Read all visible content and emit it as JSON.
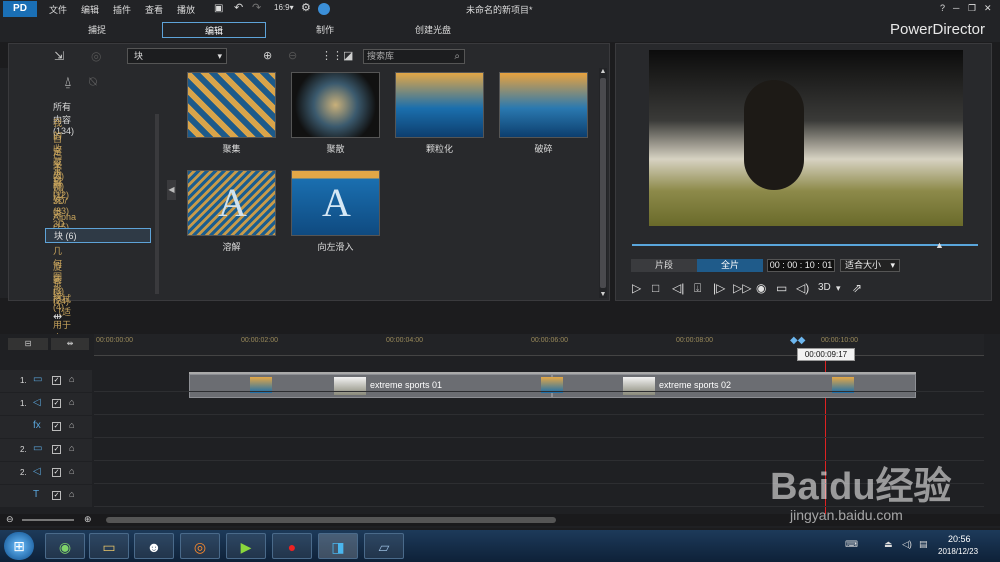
{
  "title_bar": {
    "menus": [
      "文件",
      "编辑",
      "插件",
      "查看",
      "播放"
    ],
    "project_title": "未命名的新项目*",
    "help": "?"
  },
  "modes": {
    "capture": "捕捉",
    "edit": "编辑",
    "produce": "制作",
    "disc": "创建光盘",
    "app_name": "PowerDirector"
  },
  "library": {
    "dropdown_value": "块",
    "search_placeholder": "搜索库",
    "categories": [
      {
        "label": "所有内容 (134)",
        "color": "#d8d8d8"
      },
      {
        "label": "我的收藏夹 (0)",
        "color": "#c7a35c"
      },
      {
        "label": "自定义 (0)",
        "color": "#c7a35c"
      },
      {
        "label": "已下载 (0)",
        "color": "#c7a35c"
      },
      {
        "label": "常规 (12)",
        "color": "#c7a35c"
      },
      {
        "label": "特殊 (33)",
        "color": "#c7a35c"
      },
      {
        "label": "3D/类 3D (34)",
        "color": "#c7a35c"
      },
      {
        "label": "Alpha (15)",
        "color": "#c7a35c"
      },
      {
        "label": "块 (6)",
        "color": "#e0e0e0"
      },
      {
        "label": "几何图形 (24)",
        "color": "#c7a35c"
      },
      {
        "label": "旋转 (3)",
        "color": "#c7a35c"
      },
      {
        "label": "条纹 (4)",
        "color": "#c7a35c"
      },
      {
        "label": "擦拭（适用于章节）(2)",
        "color": "#c7a35c"
      }
    ],
    "transitions": [
      "聚集",
      "聚散",
      "颗粒化",
      "破碎",
      "溶解",
      "向左滑入"
    ]
  },
  "preview": {
    "clip_label": "片段",
    "movie_label": "全片",
    "timecode": "00 : 00 : 10 : 01",
    "fit_label": "适合大小",
    "mode_3d": "3D"
  },
  "timeline": {
    "ruler": [
      "00:00:00:00",
      "00:00:02:00",
      "00:00:04:00",
      "00:00:06:00",
      "00:00:08:00",
      "00:00:10:00"
    ],
    "playhead_time": "00:00:09:17",
    "tracks": [
      "1.",
      "1.",
      "",
      "2.",
      "2.",
      ""
    ],
    "clips": [
      "extreme sports 01",
      "extreme sports 02"
    ]
  },
  "taskbar": {
    "time": "20:56",
    "date": "2018/12/23"
  },
  "watermark": {
    "text": "Baidu经验",
    "url": "jingyan.baidu.com"
  }
}
